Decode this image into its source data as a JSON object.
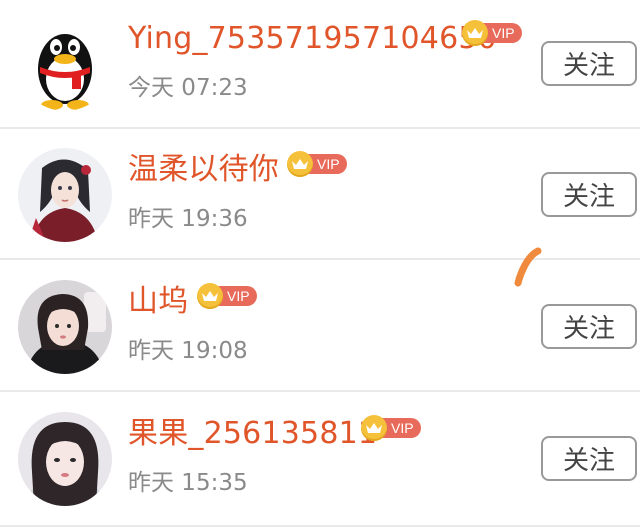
{
  "follow_list": [
    {
      "name": "Ying_753571957104650",
      "vip_label": "VIP",
      "time": "今天 07:23",
      "follow_label": "关注",
      "avatar": "penguin-avatar"
    },
    {
      "name": "温柔以待你",
      "vip_label": "VIP",
      "time": "昨天 19:36",
      "follow_label": "关注",
      "avatar": "illustrated-girl-avatar"
    },
    {
      "name": "山坞",
      "vip_label": "VIP",
      "time": "昨天 19:08",
      "follow_label": "关注",
      "avatar": "girl-photo-avatar"
    },
    {
      "name": "果果_256135811",
      "vip_label": "VIP",
      "time": "昨天 15:35",
      "follow_label": "关注",
      "avatar": "girl-selfie-avatar"
    }
  ],
  "colors": {
    "name": "#e0552a",
    "vip_tag": "#e86a5a",
    "crown": "#f6c13a",
    "time": "#8a8a8a",
    "button_border": "#999999",
    "divider": "#e9e9e9",
    "stroke_mark": "#f08a3c"
  }
}
